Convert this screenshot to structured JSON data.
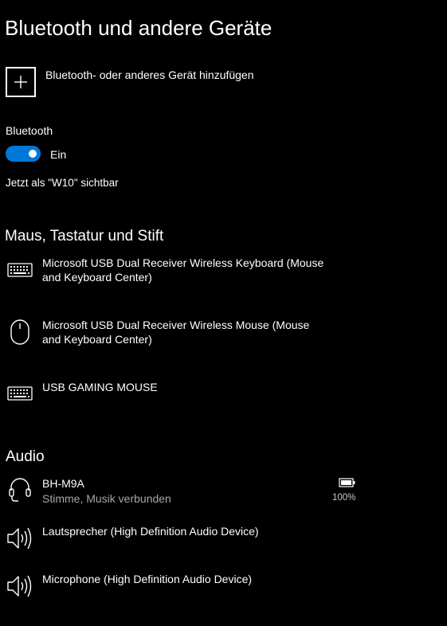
{
  "page": {
    "title": "Bluetooth und andere Geräte"
  },
  "add_device": {
    "label": "Bluetooth- oder anderes Gerät hinzufügen",
    "icon": "plus-icon"
  },
  "bluetooth": {
    "label": "Bluetooth",
    "toggle_on": true,
    "toggle_state": "Ein",
    "visibility_text": "Jetzt als \"W10\" sichtbar",
    "accent_color": "#0078d7"
  },
  "sections": {
    "input": {
      "title": "Maus, Tastatur und Stift",
      "devices": [
        {
          "name": "Microsoft USB Dual Receiver Wireless Keyboard (Mouse and Keyboard Center)",
          "icon": "keyboard-icon"
        },
        {
          "name": "Microsoft USB Dual Receiver Wireless Mouse (Mouse and Keyboard Center)",
          "icon": "mouse-icon"
        },
        {
          "name": "USB GAMING MOUSE",
          "icon": "keyboard-icon"
        }
      ]
    },
    "audio": {
      "title": "Audio",
      "devices": [
        {
          "name": "BH-M9A",
          "status": "Stimme, Musik verbunden",
          "battery": "100%",
          "icon": "headset-icon",
          "battery_icon": "battery-icon"
        },
        {
          "name": "Lautsprecher (High Definition Audio Device)",
          "icon": "speaker-icon"
        },
        {
          "name": "Microphone (High Definition Audio Device)",
          "icon": "speaker-icon"
        }
      ]
    }
  }
}
